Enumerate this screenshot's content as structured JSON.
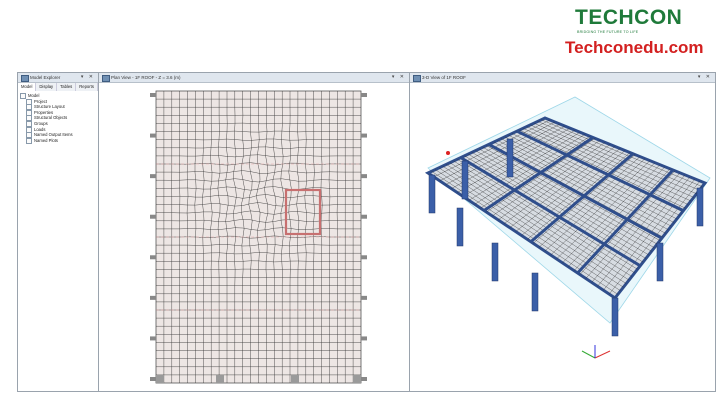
{
  "branding": {
    "logo_text": "TECHCON",
    "logo_tagline": "BRIDGING THE FUTURE TO LIFE",
    "website": "Techconedu.com"
  },
  "explorer": {
    "title": "Model Explorer",
    "tabs": [
      "Model",
      "Display",
      "Tables",
      "Reports"
    ],
    "tree": [
      {
        "label": "Model",
        "level": 0
      },
      {
        "label": "Project",
        "level": 1
      },
      {
        "label": "Structure Layout",
        "level": 1
      },
      {
        "label": "Properties",
        "level": 1
      },
      {
        "label": "Structural Objects",
        "level": 1
      },
      {
        "label": "Groups",
        "level": 1
      },
      {
        "label": "Loads",
        "level": 1
      },
      {
        "label": "Named Output Items",
        "level": 1
      },
      {
        "label": "Named Plots",
        "level": 1
      }
    ]
  },
  "plan_view": {
    "title": "Plan View - 1F ROOF - Z = 3.6 (m)"
  },
  "view_3d": {
    "title": "3-D View of 1F ROOF"
  },
  "colors": {
    "beam": "#2f4e8c",
    "mesh": "#2a2a2a",
    "plan_fill": "#ede6e4",
    "highlight": "#c77070",
    "brand_green": "#1f7a3a",
    "brand_red": "#d32020"
  }
}
